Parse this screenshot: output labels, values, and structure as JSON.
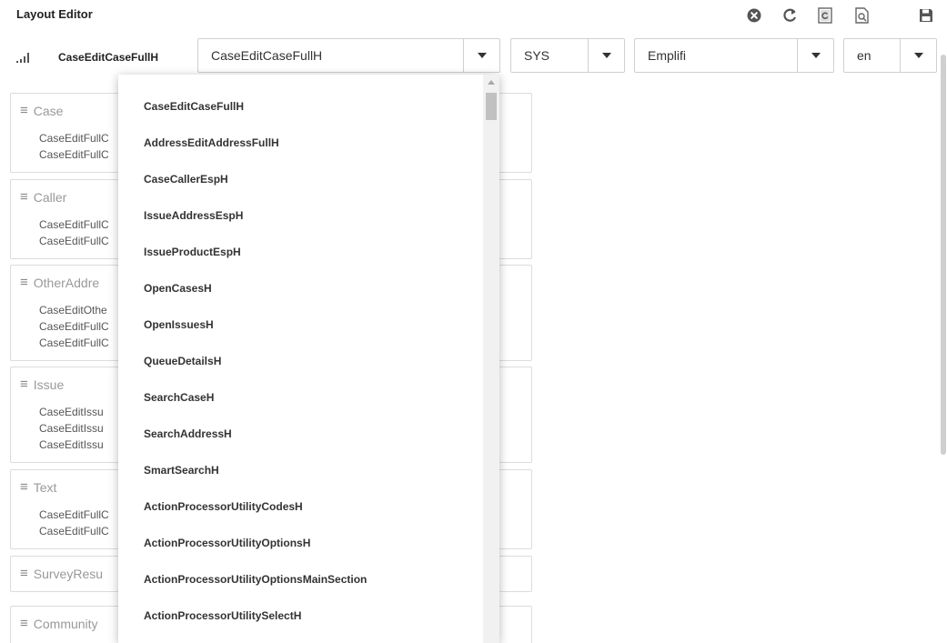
{
  "app": {
    "title": "Layout Editor"
  },
  "toolbar": [
    {
      "name": "close-circle-icon"
    },
    {
      "name": "refresh-icon"
    },
    {
      "name": "reload-document-icon"
    },
    {
      "name": "preview-icon"
    },
    {
      "name": "save-icon"
    }
  ],
  "selector": {
    "layout_name": "CaseEditCaseFullH",
    "layout_value": "CaseEditCaseFullH",
    "system_value": "SYS",
    "theme_value": "Emplifi",
    "language_value": "en"
  },
  "sections": [
    {
      "title": "Case",
      "items": [
        "CaseEditFullC",
        "CaseEditFullC"
      ]
    },
    {
      "title": "Caller",
      "items": [
        "CaseEditFullC",
        "CaseEditFullC"
      ]
    },
    {
      "title": "OtherAddre",
      "items": [
        "CaseEditOthe",
        "CaseEditFullC",
        "CaseEditFullC"
      ]
    },
    {
      "title": "Issue",
      "items": [
        "CaseEditIssu",
        "CaseEditIssu",
        "CaseEditIssu"
      ]
    },
    {
      "title": "Text",
      "items": [
        "CaseEditFullC",
        "CaseEditFullC"
      ]
    },
    {
      "title": "SurveyResu",
      "items": []
    },
    {
      "title": "Community",
      "items": []
    }
  ],
  "dropdown": {
    "options": [
      "CaseEditCaseFullH",
      "AddressEditAddressFullH",
      "CaseCallerEspH",
      "IssueAddressEspH",
      "IssueProductEspH",
      "OpenCasesH",
      "OpenIssuesH",
      "QueueDetailsH",
      "SearchCaseH",
      "SearchAddressH",
      "SmartSearchH",
      "ActionProcessorUtilityCodesH",
      "ActionProcessorUtilityOptionsH",
      "ActionProcessorUtilityOptionsMainSection",
      "ActionProcessorUtilitySelectH"
    ]
  }
}
